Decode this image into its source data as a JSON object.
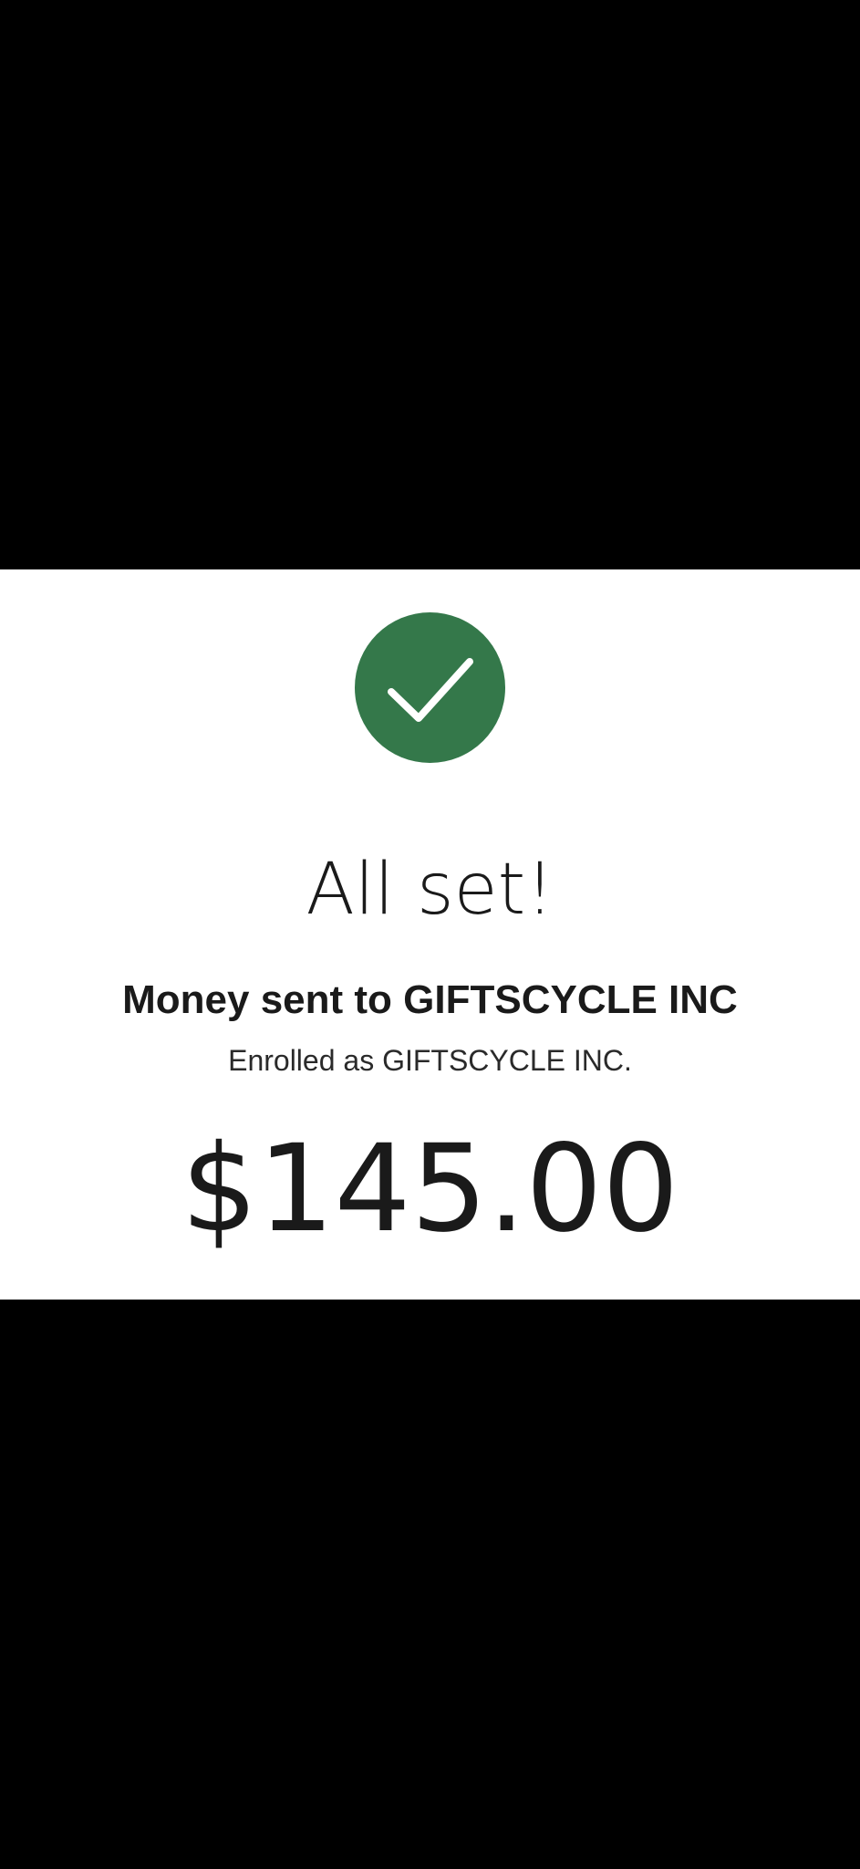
{
  "confirmation": {
    "icon": "checkmark-icon",
    "accent_color": "#34784a",
    "title": "All set!",
    "subtitle": "Money sent to GIFTSCYCLE INC",
    "enrolled_text": "Enrolled as GIFTSCYCLE INC.",
    "amount": "$145.00"
  }
}
